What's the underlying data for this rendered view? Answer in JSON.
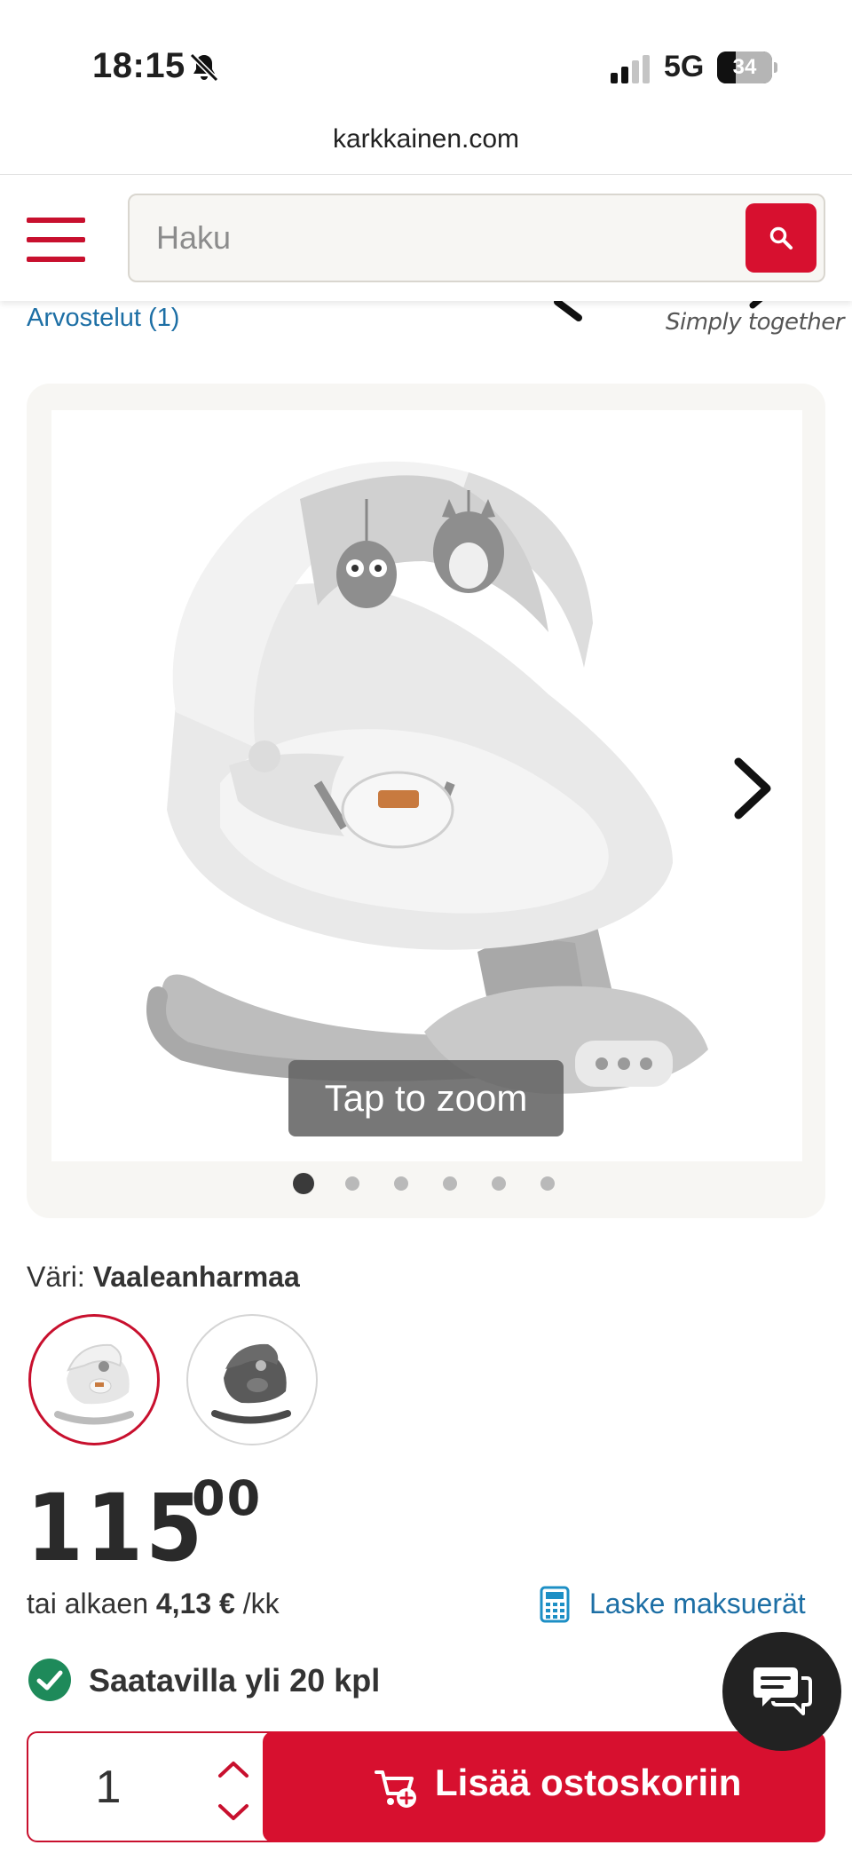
{
  "status_bar": {
    "time": "18:15",
    "network": "5G",
    "battery": "34",
    "battery_level": 0.34
  },
  "browser": {
    "url": "karkkainen.com"
  },
  "header": {
    "search_placeholder": "Haku",
    "menu_icon": "hamburger-icon",
    "search_icon": "search-icon"
  },
  "product": {
    "reviews_link": "Arvostelut (1)",
    "brand_tagline": "Simply together",
    "gallery": {
      "zoom_hint": "Tap to zoom",
      "image_count": 6,
      "active_index": 0
    },
    "variant": {
      "label": "Väri:",
      "selected": "Vaaleanharmaa",
      "options": [
        "light-grey",
        "dark-grey"
      ]
    },
    "price": {
      "main": "115",
      "decimals": "00"
    },
    "installment": {
      "prefix": "tai alkaen",
      "amount": "4,13 €",
      "suffix": "/kk",
      "calc_link": "Laske maksuerät"
    },
    "availability": "Saatavilla yli 20 kpl",
    "quantity": "1",
    "add_to_cart": "Lisää ostoskoriin"
  },
  "colors": {
    "brand_red": "#d7102f",
    "link_blue": "#1d6fa5",
    "available_green": "#1e8a5a"
  }
}
